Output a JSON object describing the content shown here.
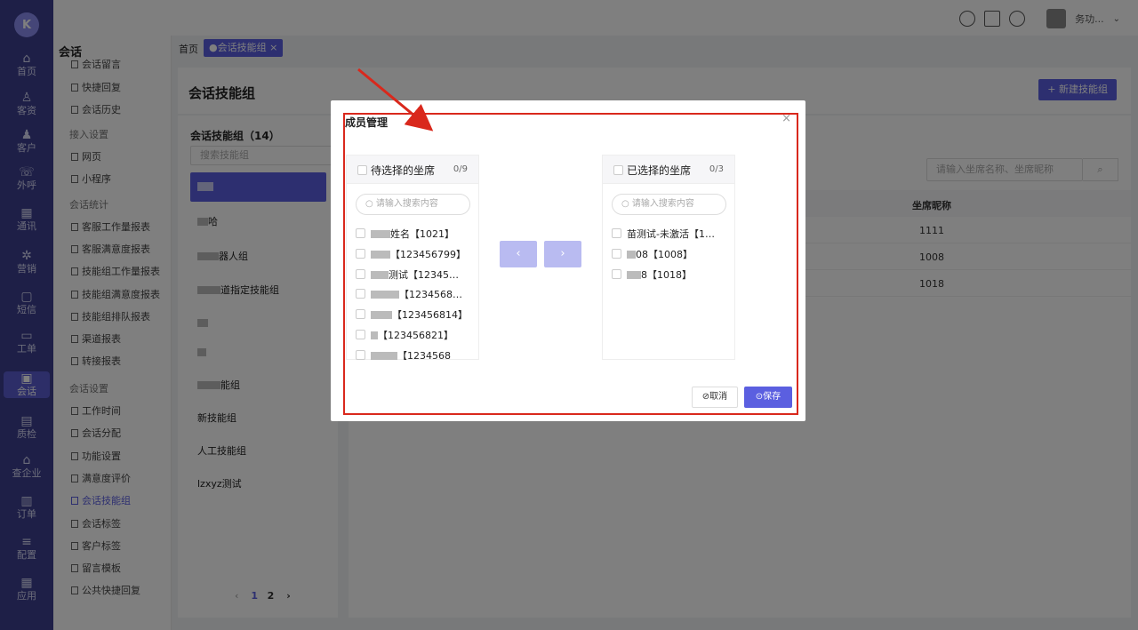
{
  "rail": {
    "items": [
      {
        "label": "首页",
        "icon": "home-icon",
        "glyph": "⌂"
      },
      {
        "label": "客资",
        "icon": "customer-lead-icon",
        "glyph": "♙"
      },
      {
        "label": "客户",
        "icon": "customer-icon",
        "glyph": "♟"
      },
      {
        "label": "外呼",
        "icon": "phone-icon",
        "glyph": "☏"
      },
      {
        "label": "通讯",
        "icon": "contacts-icon",
        "glyph": "▦"
      },
      {
        "label": "营销",
        "icon": "marketing-icon",
        "glyph": "✲"
      },
      {
        "label": "短信",
        "icon": "sms-icon",
        "glyph": "▢"
      },
      {
        "label": "工单",
        "icon": "ticket-icon",
        "glyph": "▭"
      },
      {
        "label": "会话",
        "icon": "chat-icon",
        "glyph": "▣"
      },
      {
        "label": "质检",
        "icon": "quality-icon",
        "glyph": "▤"
      },
      {
        "label": "查企业",
        "icon": "company-icon",
        "glyph": "⌂"
      },
      {
        "label": "订单",
        "icon": "order-icon",
        "glyph": "▥"
      },
      {
        "label": "配置",
        "icon": "config-icon",
        "glyph": "≡"
      },
      {
        "label": "应用",
        "icon": "apps-icon",
        "glyph": "▦"
      }
    ]
  },
  "header": {
    "user_suffix": "务功..."
  },
  "subnav": {
    "title": "会话",
    "partial_top": "会话留言",
    "items_block1": [
      "快捷回复",
      "会话历史"
    ],
    "group_access": "接入设置",
    "items_block2": [
      "网页",
      "小程序"
    ],
    "group_stats": "会话统计",
    "items_block3": [
      "客服工作量报表",
      "客服满意度报表",
      "技能组工作量报表",
      "技能组满意度报表",
      "技能组排队报表",
      "渠道报表",
      "转接报表"
    ],
    "group_settings": "会话设置",
    "items_block4": [
      "工作时间",
      "会话分配",
      "功能设置",
      "满意度评价",
      "会话技能组",
      "会话标签",
      "客户标签",
      "留言模板",
      "公共快捷回复"
    ],
    "active": "会话技能组"
  },
  "tabs": {
    "home": "首页",
    "active": "●会话技能组 ×"
  },
  "page": {
    "title": "会话技能组",
    "new_button": "+ 新建技能组"
  },
  "groups": {
    "title": "会话技能组（14）",
    "search_placeholder": "搜索技能组",
    "items": [
      {
        "text": "",
        "blur": 18
      },
      {
        "text": "哈",
        "blur": 12
      },
      {
        "text": "器人组",
        "blur": 24
      },
      {
        "text": "道指定技能组",
        "blur": 26
      },
      {
        "text": "",
        "blur": 12
      },
      {
        "text": "",
        "blur": 10
      },
      {
        "text": "能组",
        "blur": 26
      },
      {
        "text": "新技能组",
        "blur": 0
      },
      {
        "text": "人工技能组",
        "blur": 0
      },
      {
        "text": "lzxyz测试",
        "blur": 0
      }
    ],
    "pager": {
      "prev": "‹",
      "p1": "1",
      "p2": "2",
      "next": "›"
    }
  },
  "agents_table": {
    "search_placeholder": "请输入坐席名称、坐席昵称",
    "search_button": "⌕",
    "col_header": "坐席昵称",
    "rows": [
      "1111",
      "1008",
      "1018"
    ]
  },
  "modal": {
    "title": "成员管理",
    "close": "×",
    "left": {
      "title": "待选择的坐席",
      "count": "0/9",
      "search_placeholder": "请输入搜索内容",
      "items": [
        {
          "text": "姓名【1021】",
          "blur": 22
        },
        {
          "text": "【123456799】",
          "blur": 22
        },
        {
          "text": "测试【12345…",
          "blur": 20
        },
        {
          "text": "【1234568…",
          "blur": 32
        },
        {
          "text": "【123456814】",
          "blur": 24
        },
        {
          "text": "【123456821】",
          "blur": 8
        },
        {
          "text": "【1234568",
          "blur": 30
        }
      ]
    },
    "right": {
      "title": "已选择的坐席",
      "count": "0/3",
      "search_placeholder": "请输入搜索内容",
      "items": [
        {
          "text": "苗测试-未激活【1…",
          "blur": 0
        },
        {
          "text": "08【1008】",
          "blur": 10
        },
        {
          "text": "8【1018】",
          "blur": 16
        }
      ]
    },
    "move_left": "‹",
    "move_right": "›",
    "cancel": "⊘取消",
    "save": "⊙保存"
  },
  "colors": {
    "accent": "#5b5fe0",
    "rail": "#3d3f8f",
    "annotation": "#d9281c"
  }
}
